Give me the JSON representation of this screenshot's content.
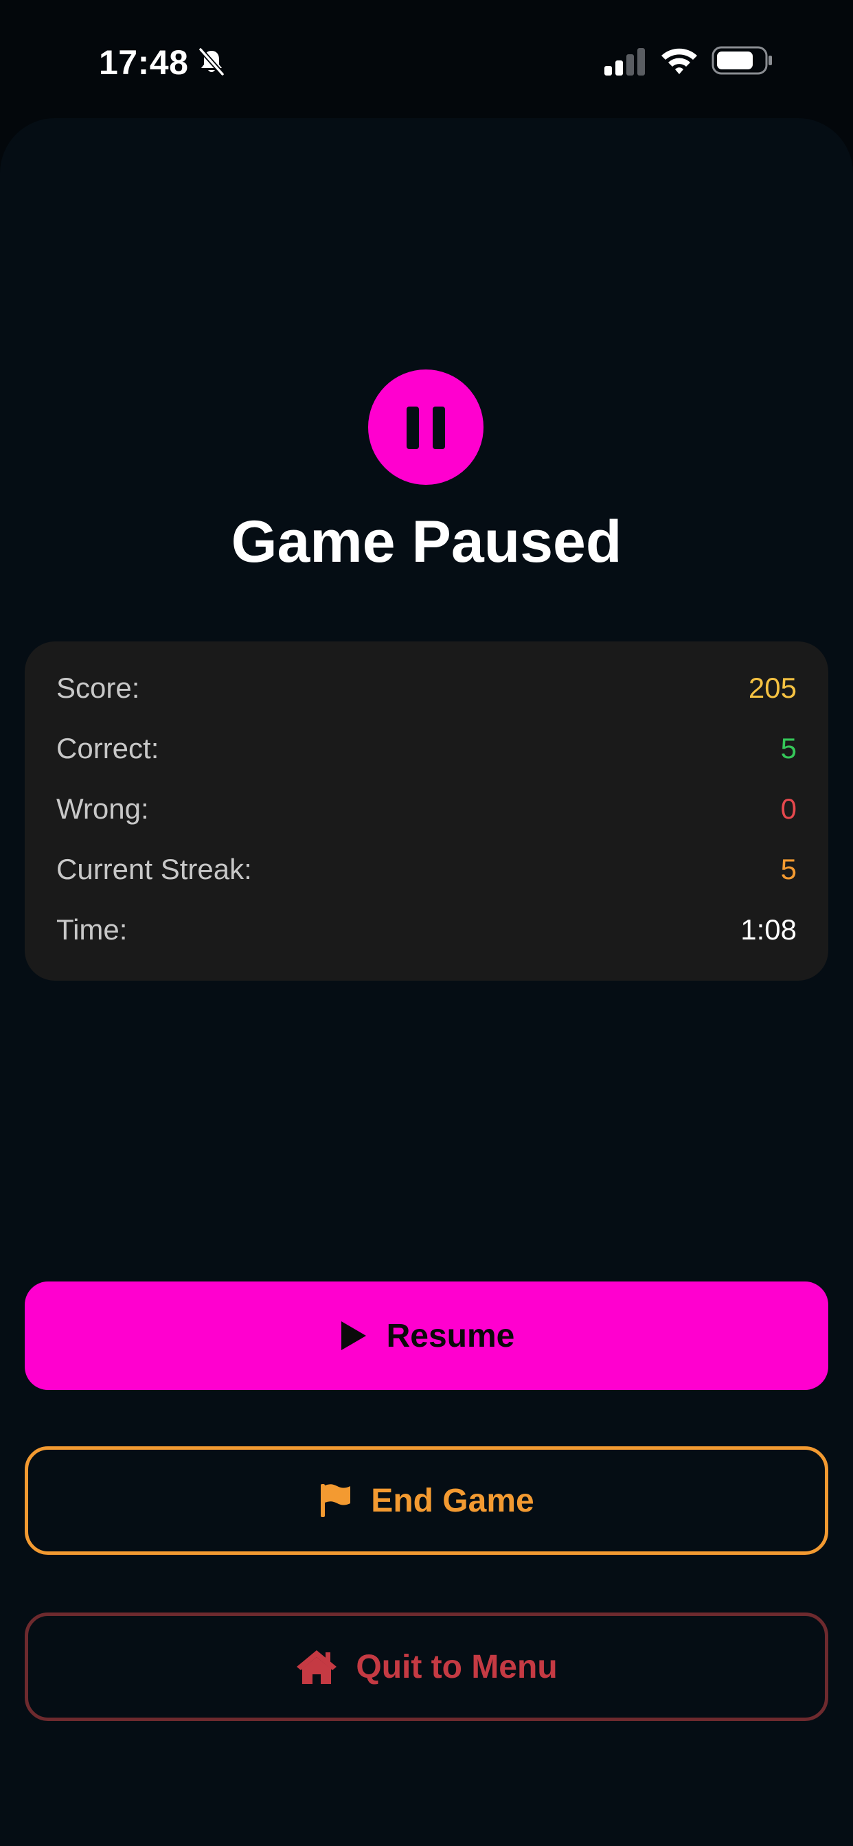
{
  "status_bar": {
    "time": "17:48",
    "icons": [
      "bell-slash-icon",
      "signal-icon",
      "wifi-icon",
      "battery-icon"
    ]
  },
  "pause_screen": {
    "icon": "pause-icon",
    "title": "Game Paused"
  },
  "stats": [
    {
      "label": "Score:",
      "value": "205",
      "color": "#f5c242"
    },
    {
      "label": "Correct:",
      "value": "5",
      "color": "#35c759"
    },
    {
      "label": "Wrong:",
      "value": "0",
      "color": "#e5484d"
    },
    {
      "label": "Current Streak:",
      "value": "5",
      "color": "#f39a31"
    },
    {
      "label": "Time:",
      "value": "1:08",
      "color": "#ffffff"
    }
  ],
  "buttons": {
    "resume": {
      "label": "Resume",
      "icon": "play-icon"
    },
    "end_game": {
      "label": "End Game",
      "icon": "flag-icon"
    },
    "quit": {
      "label": "Quit to Menu",
      "icon": "home-icon"
    }
  },
  "colors": {
    "accent": "#ff00cf",
    "end_game": "#f39a31",
    "quit": "#c53a43",
    "background": "#050d14",
    "card": "#1a1a1a"
  }
}
